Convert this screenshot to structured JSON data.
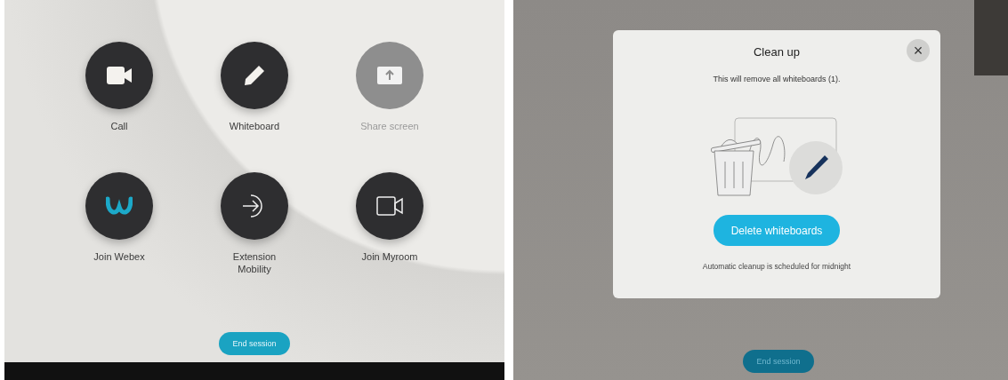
{
  "home_screen": {
    "tiles": [
      {
        "label": "Call",
        "kind": "camera",
        "disabled": false
      },
      {
        "label": "Whiteboard",
        "kind": "pencil",
        "disabled": false
      },
      {
        "label": "Share screen",
        "kind": "share",
        "disabled": true
      },
      {
        "label": "Join Webex",
        "kind": "webex",
        "disabled": false
      },
      {
        "label": "Extension Mobility",
        "kind": "enter",
        "disabled": false
      },
      {
        "label": "Join Myroom",
        "kind": "video",
        "disabled": false
      }
    ],
    "end_button": "End session"
  },
  "cleanup_screen": {
    "dialog": {
      "title": "Clean up",
      "close": "×",
      "message": "This will remove all whiteboards (1).",
      "button": "Delete whiteboards",
      "note": "Automatic cleanup is scheduled for midnight"
    },
    "end_button": "End session"
  }
}
